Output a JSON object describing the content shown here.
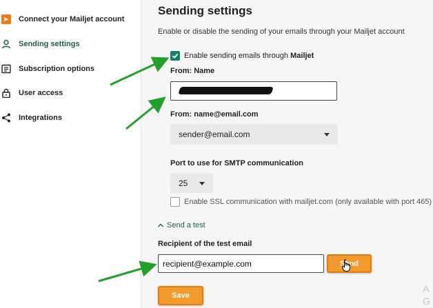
{
  "sidebar": {
    "items": [
      {
        "label": "Connect your Mailjet account",
        "icon": "mailjet-logo-icon"
      },
      {
        "label": "Sending settings",
        "icon": "user-icon"
      },
      {
        "label": "Subscription options",
        "icon": "list-icon"
      },
      {
        "label": "User access",
        "icon": "lock-icon"
      },
      {
        "label": "Integrations",
        "icon": "share-icon"
      }
    ],
    "active_index": 1
  },
  "main": {
    "title": "Sending settings",
    "description": "Enable or disable the sending of your emails through your Mailjet account",
    "enable_label_prefix": "Enable sending emails through ",
    "enable_label_brand": "Mailjet",
    "enable_checked": true,
    "from_name_label": "From: Name",
    "from_name_value": "",
    "from_email_label": "From: name@email.com",
    "from_email_value": "sender@email.com",
    "port_label": "Port to use for SMTP communication",
    "port_value": "25",
    "ssl_label": "Enable SSL communication with mailjet.com (only available with port 465)",
    "ssl_checked": false,
    "send_test_label": "Send a test",
    "recipient_label": "Recipient of the test email",
    "recipient_value": "recipient@example.com",
    "send_button": "Send",
    "save_button": "Save"
  },
  "corner_text": [
    "A",
    "G"
  ],
  "colors": {
    "accent_green": "#16826a",
    "button_orange": "#f29b2c",
    "annotation_arrow": "#22a12a"
  }
}
